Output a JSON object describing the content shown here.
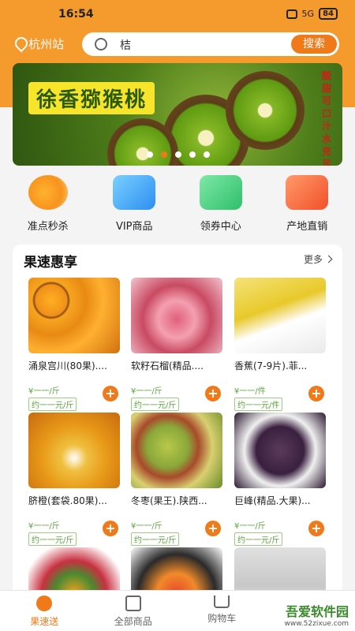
{
  "status": {
    "time": "16:54",
    "battery": "84",
    "signal": "5G"
  },
  "header": {
    "location": "杭州站",
    "search_query": "桔",
    "search_button": "搜索"
  },
  "banner": {
    "title": "徐香猕猴桃",
    "side_text": "酸甜可口汁水充足"
  },
  "quick_links": [
    {
      "label": "准点秒杀",
      "icon": "flash-sale-icon"
    },
    {
      "label": "VIP商品",
      "icon": "vip-icon"
    },
    {
      "label": "领券中心",
      "icon": "coupon-icon"
    },
    {
      "label": "产地直销",
      "icon": "truck-icon"
    }
  ],
  "section": {
    "title": "果速惠享",
    "more": "更多"
  },
  "products": [
    {
      "name": "涌泉宫川(80果)....",
      "price": "¥一一/斤",
      "tag": "约一一元/斤"
    },
    {
      "name": "软籽石榴(精品....",
      "price": "¥一一/斤",
      "tag": "约一一元/斤"
    },
    {
      "name": "香蕉(7-9片).菲...",
      "price": "¥一一/件",
      "tag": "约一一元/件"
    },
    {
      "name": "脐橙(套袋.80果)...",
      "price": "¥一一/斤",
      "tag": "约一一元/斤"
    },
    {
      "name": "冬枣(果王).陕西...",
      "price": "¥一一/斤",
      "tag": "约一一元/斤"
    },
    {
      "name": "巨峰(精品.大果)...",
      "price": "¥一一/斤",
      "tag": "约一一元/斤"
    }
  ],
  "tabs": [
    {
      "label": "果速送",
      "active": true
    },
    {
      "label": "全部商品",
      "active": false
    },
    {
      "label": "购物车",
      "active": false
    }
  ],
  "watermark": {
    "title": "吾爱软件园",
    "url": "www.52zixue.com"
  },
  "colors": {
    "brand": "#f59a2c",
    "accent": "#f07a1a",
    "price_green": "#5aa33c"
  }
}
